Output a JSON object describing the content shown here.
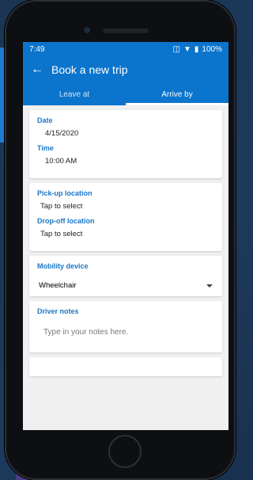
{
  "status": {
    "time": "7:49",
    "battery": "100%"
  },
  "appbar": {
    "title": "Book a new trip"
  },
  "tabs": [
    {
      "label": "Leave at"
    },
    {
      "label": "Arrive by"
    }
  ],
  "date": {
    "label": "Date",
    "value": "4/15/2020"
  },
  "time": {
    "label": "Time",
    "value": "10:00 AM"
  },
  "pickup": {
    "label": "Pick-up location",
    "value": "Tap to select"
  },
  "dropoff": {
    "label": "Drop-off location",
    "value": "Tap to select"
  },
  "mobility": {
    "label": "Mobility device",
    "value": "Wheelchair"
  },
  "notes": {
    "label": "Driver notes",
    "placeholder": "Type in your notes here."
  },
  "colors": {
    "primary": "#0b74cc",
    "accent": "#1a76c6",
    "background": "#f0f0f0"
  }
}
